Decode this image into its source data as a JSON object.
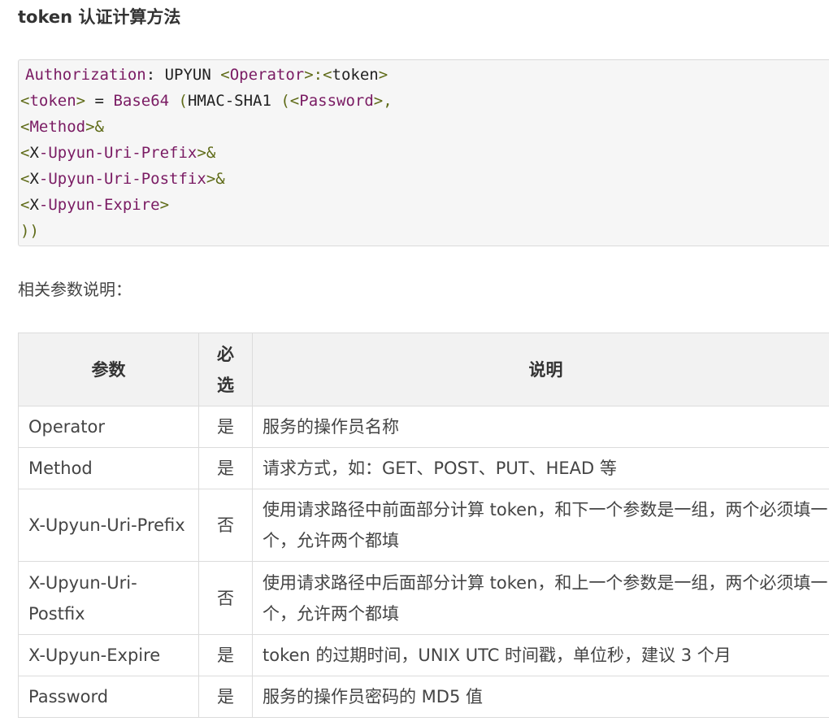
{
  "heading": "token 认证计算方法",
  "code_lines": [
    [
      {
        "t": "Authorization",
        "c": "c-key"
      },
      {
        "t": ": UPYUN ",
        "c": "c-plain"
      },
      {
        "t": "<",
        "c": "c-br"
      },
      {
        "t": "Operator",
        "c": "c-tag"
      },
      {
        "t": ">:<",
        "c": "c-br"
      },
      {
        "t": "token",
        "c": "c-plain"
      },
      {
        "t": ">",
        "c": "c-br"
      }
    ],
    [
      {
        "t": "<",
        "c": "c-br"
      },
      {
        "t": "token",
        "c": "c-tag"
      },
      {
        "t": ">",
        "c": "c-br"
      },
      {
        "t": " = ",
        "c": "c-plain"
      },
      {
        "t": "Base64",
        "c": "c-tag"
      },
      {
        "t": " (",
        "c": "c-br"
      },
      {
        "t": "HMAC-SHA1",
        "c": "c-plain"
      },
      {
        "t": " (<",
        "c": "c-br"
      },
      {
        "t": "Password",
        "c": "c-tag"
      },
      {
        "t": ">,",
        "c": "c-br"
      }
    ],
    [
      {
        "t": "<",
        "c": "c-br"
      },
      {
        "t": "Method",
        "c": "c-tag"
      },
      {
        "t": ">&",
        "c": "c-br"
      }
    ],
    [
      {
        "t": "<",
        "c": "c-br"
      },
      {
        "t": "X",
        "c": "c-plain"
      },
      {
        "t": "-Upyun-Uri-Prefix",
        "c": "c-tag"
      },
      {
        "t": ">&",
        "c": "c-br"
      }
    ],
    [
      {
        "t": "<",
        "c": "c-br"
      },
      {
        "t": "X",
        "c": "c-plain"
      },
      {
        "t": "-Upyun-Uri-Postfix",
        "c": "c-tag"
      },
      {
        "t": ">&",
        "c": "c-br"
      }
    ],
    [
      {
        "t": "<",
        "c": "c-br"
      },
      {
        "t": "X",
        "c": "c-plain"
      },
      {
        "t": "-Upyun-Expire",
        "c": "c-tag"
      },
      {
        "t": ">",
        "c": "c-br"
      }
    ],
    [
      {
        "t": "))",
        "c": "c-br"
      }
    ]
  ],
  "intro": "相关参数说明：",
  "table": {
    "headers": {
      "param": "参数",
      "required": "必选",
      "desc": "说明"
    },
    "rows": [
      {
        "param": "Operator",
        "required": "是",
        "desc": "服务的操作员名称"
      },
      {
        "param": "Method",
        "required": "是",
        "desc": "请求方式，如：GET、POST、PUT、HEAD 等"
      },
      {
        "param": "X-Upyun-Uri-Prefix",
        "required": "否",
        "desc": "使用请求路径中前面部分计算 token，和下一个参数是一组，两个必须填一个，允许两个都填"
      },
      {
        "param": "X-Upyun-Uri-Postfix",
        "required": "否",
        "desc": "使用请求路径中后面部分计算 token，和上一个参数是一组，两个必须填一个，允许两个都填"
      },
      {
        "param": "X-Upyun-Expire",
        "required": "是",
        "desc": "token 的过期时间，UNIX UTC 时间戳，单位秒，建议 3 个月"
      },
      {
        "param": "Password",
        "required": "是",
        "desc": "服务的操作员密码的 MD5 值"
      }
    ]
  }
}
